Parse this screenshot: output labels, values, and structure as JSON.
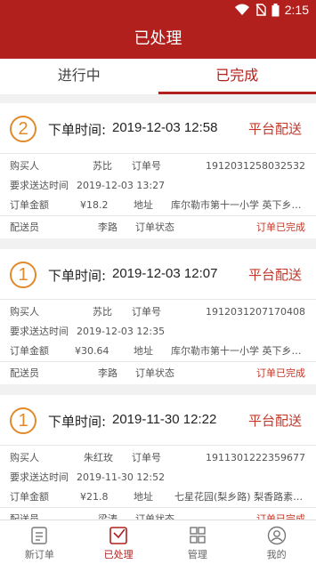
{
  "status_bar": {
    "time": "2:15"
  },
  "header": {
    "title": "已处理"
  },
  "tabs": [
    {
      "label": "进行中",
      "active": false
    },
    {
      "label": "已完成",
      "active": true
    }
  ],
  "labels": {
    "order_time": "下单时间:",
    "buyer": "购买人",
    "order_no": "订单号",
    "required_delivery": "要求送达时间",
    "amount": "订单金额",
    "address": "地址",
    "courier": "配送员",
    "status": "订单状态"
  },
  "orders": [
    {
      "index": "2",
      "order_time": "2019-12-03 12:58",
      "badge": "平台配送",
      "buyer": "苏比",
      "order_no": "1912031258032532",
      "required_time": "2019-12-03 13:27",
      "amount": "¥18.2",
      "address": "库尔勒市第十一小学 英下乡英...",
      "courier": "李路",
      "status": "订单已完成"
    },
    {
      "index": "1",
      "order_time": "2019-12-03 12:07",
      "badge": "平台配送",
      "buyer": "苏比",
      "order_no": "1912031207170408",
      "required_time": "2019-12-03 12:35",
      "amount": "¥30.64",
      "address": "库尔勒市第十一小学 英下乡英...",
      "courier": "李路",
      "status": "订单已完成"
    },
    {
      "index": "1",
      "order_time": "2019-11-30 12:22",
      "badge": "平台配送",
      "buyer": "朱红玫",
      "order_no": "1911301222359677",
      "required_time": "2019-11-30 12:52",
      "amount": "¥21.8",
      "address": "七星花园(梨乡路) 梨香路素景...",
      "courier": "梁涛",
      "status": "订单已完成"
    }
  ],
  "bottom_nav": [
    {
      "label": "新订单",
      "icon": "list-icon",
      "active": false
    },
    {
      "label": "已处理",
      "icon": "inbox-check-icon",
      "active": true
    },
    {
      "label": "管理",
      "icon": "grid-icon",
      "active": false
    },
    {
      "label": "我的",
      "icon": "user-icon",
      "active": false
    }
  ],
  "colors": {
    "brand": "#b1201d",
    "accent_orange": "#e2892a",
    "status_red": "#c0392b"
  }
}
